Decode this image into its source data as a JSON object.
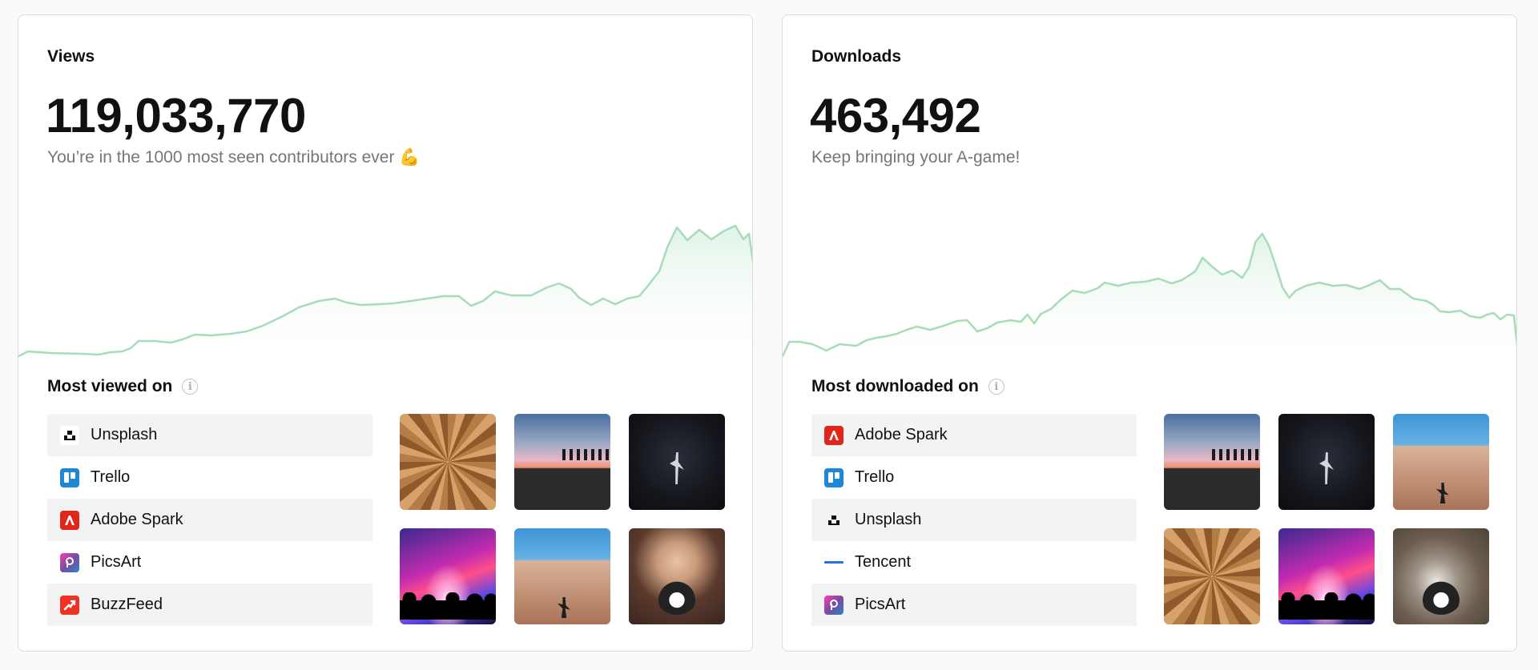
{
  "colors": {
    "sparkline_stroke": "#a8dcb9",
    "sparkline_fill_top": "#e3f5ea",
    "card_border": "#dcdcdc",
    "row_background": "#f3f3f3"
  },
  "cards": [
    {
      "label": "Views",
      "value": "119,033,770",
      "subtitle": "You’re in the 1000 most seen contributors ever 💪",
      "section_title": "Most viewed on",
      "platforms": [
        {
          "name": "Unsplash",
          "icon": "unsplash-icon"
        },
        {
          "name": "Trello",
          "icon": "trello-icon"
        },
        {
          "name": "Adobe Spark",
          "icon": "adobe-spark-icon"
        },
        {
          "name": "PicsArt",
          "icon": "picsart-icon"
        },
        {
          "name": "BuzzFeed",
          "icon": "buzzfeed-icon"
        }
      ],
      "thumbnails": [
        "wood-ceiling",
        "sunset-silhouettes",
        "ballet-dancer",
        "concert-lights",
        "desert-dunes",
        "girl-with-puppy"
      ]
    },
    {
      "label": "Downloads",
      "value": "463,492",
      "subtitle": "Keep bringing your A-game!",
      "section_title": "Most downloaded on",
      "platforms": [
        {
          "name": "Adobe Spark",
          "icon": "adobe-spark-icon"
        },
        {
          "name": "Trello",
          "icon": "trello-icon"
        },
        {
          "name": "Unsplash",
          "icon": "unsplash-icon"
        },
        {
          "name": "Tencent",
          "icon": "tencent-icon"
        },
        {
          "name": "PicsArt",
          "icon": "picsart-icon"
        }
      ],
      "thumbnails": [
        "sunset-silhouettes",
        "ballet-dancer",
        "desert-dunes",
        "wood-ceiling",
        "concert-lights",
        "puppy"
      ]
    }
  ]
}
